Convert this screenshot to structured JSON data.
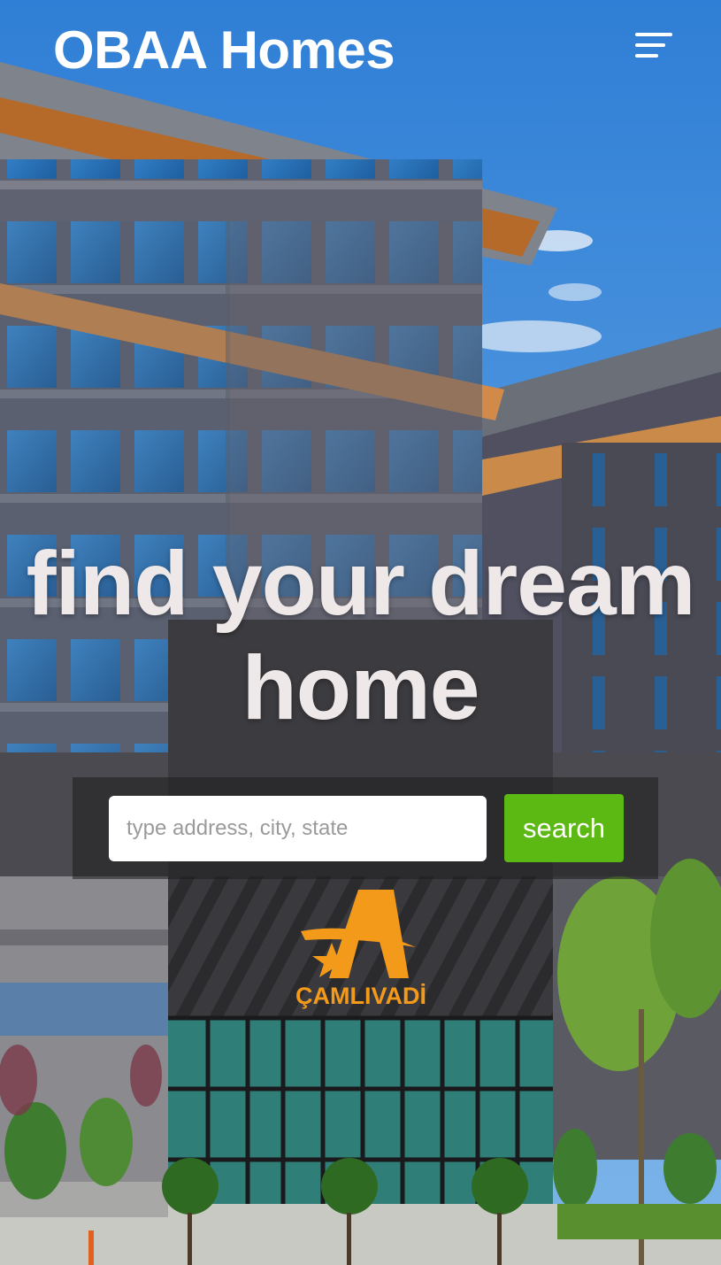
{
  "header": {
    "brand": "OBAA Homes",
    "menu_icon": "menu-icon"
  },
  "hero": {
    "title": "find your dream home",
    "background_image": "apartment-building-photo"
  },
  "search": {
    "placeholder": "type address, city, state",
    "value": "",
    "button_label": "search"
  },
  "sign": {
    "logo_text": "ÇAMLIVADİ"
  },
  "colors": {
    "search_button": "#5cb812",
    "title_text": "#efe8e8",
    "brand_text": "#ffffff"
  }
}
